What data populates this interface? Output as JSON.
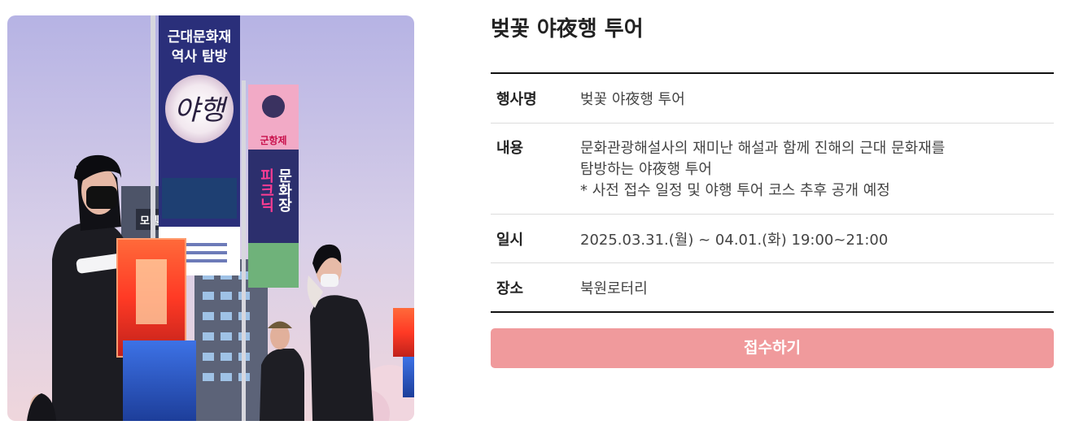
{
  "event": {
    "title": "벚꽃 야夜행 투어",
    "photo_alt": "벚꽃 야夜행 투어"
  },
  "details": {
    "name_label": "행사명",
    "name_value": "벚꽃 야夜행 투어",
    "content_label": "내용",
    "content_lines": [
      "문화관광해설사의 재미난 해설과 함께 진해의 근대 문화재를",
      "탐방하는 야夜행 투어",
      "* 사전 접수 일정 및 야행 투어 코스 추후 공개 예정"
    ],
    "date_label": "일시",
    "date_value": "2025.03.31.(월) ~ 04.01.(화) 19:00~21:00",
    "place_label": "장소",
    "place_value": "북원로터리"
  },
  "apply_button": {
    "label": "접수하기"
  },
  "banners": {
    "left_top": "근대문화재",
    "left_mid": "역사 탐방",
    "left_calligraphy": "야행",
    "right_top": "군항제",
    "right_vertical_1": "피크닉",
    "right_vertical_2": "문화장",
    "sign_left": "모텔"
  },
  "colors": {
    "accent_button": "#f09a9c",
    "sky_top": "#b8b8e6",
    "banner_navy": "#2a2f7a",
    "banner_pink": "#e0508a",
    "lantern_red": "#e8342b",
    "lantern_blue": "#2e5fd0"
  }
}
